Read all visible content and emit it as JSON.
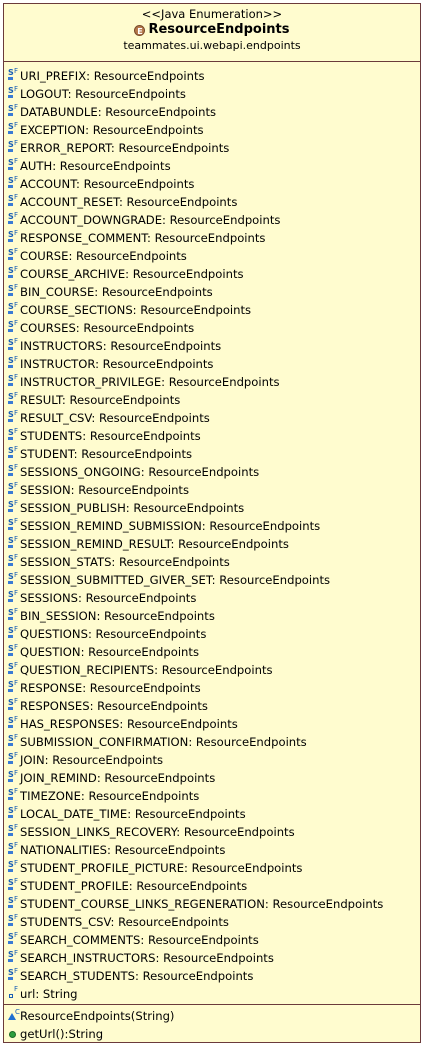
{
  "header": {
    "stereotype": "<<Java Enumeration>>",
    "icon_letter": "E",
    "name": "ResourceEndpoints",
    "package": "teammates.ui.webapi.endpoints"
  },
  "fields": [
    {
      "text": "URI_PREFIX: ResourceEndpoints"
    },
    {
      "text": "LOGOUT: ResourceEndpoints"
    },
    {
      "text": "DATABUNDLE: ResourceEndpoints"
    },
    {
      "text": "EXCEPTION: ResourceEndpoints"
    },
    {
      "text": "ERROR_REPORT: ResourceEndpoints"
    },
    {
      "text": "AUTH: ResourceEndpoints"
    },
    {
      "text": "ACCOUNT: ResourceEndpoints"
    },
    {
      "text": "ACCOUNT_RESET: ResourceEndpoints"
    },
    {
      "text": "ACCOUNT_DOWNGRADE: ResourceEndpoints"
    },
    {
      "text": "RESPONSE_COMMENT: ResourceEndpoints"
    },
    {
      "text": "COURSE: ResourceEndpoints"
    },
    {
      "text": "COURSE_ARCHIVE: ResourceEndpoints"
    },
    {
      "text": "BIN_COURSE: ResourceEndpoints"
    },
    {
      "text": "COURSE_SECTIONS: ResourceEndpoints"
    },
    {
      "text": "COURSES: ResourceEndpoints"
    },
    {
      "text": "INSTRUCTORS: ResourceEndpoints"
    },
    {
      "text": "INSTRUCTOR: ResourceEndpoints"
    },
    {
      "text": "INSTRUCTOR_PRIVILEGE: ResourceEndpoints"
    },
    {
      "text": "RESULT: ResourceEndpoints"
    },
    {
      "text": "RESULT_CSV: ResourceEndpoints"
    },
    {
      "text": "STUDENTS: ResourceEndpoints"
    },
    {
      "text": "STUDENT: ResourceEndpoints"
    },
    {
      "text": "SESSIONS_ONGOING: ResourceEndpoints"
    },
    {
      "text": "SESSION: ResourceEndpoints"
    },
    {
      "text": "SESSION_PUBLISH: ResourceEndpoints"
    },
    {
      "text": "SESSION_REMIND_SUBMISSION: ResourceEndpoints"
    },
    {
      "text": "SESSION_REMIND_RESULT: ResourceEndpoints"
    },
    {
      "text": "SESSION_STATS: ResourceEndpoints"
    },
    {
      "text": "SESSION_SUBMITTED_GIVER_SET: ResourceEndpoints"
    },
    {
      "text": "SESSIONS: ResourceEndpoints"
    },
    {
      "text": "BIN_SESSION: ResourceEndpoints"
    },
    {
      "text": "QUESTIONS: ResourceEndpoints"
    },
    {
      "text": "QUESTION: ResourceEndpoints"
    },
    {
      "text": "QUESTION_RECIPIENTS: ResourceEndpoints"
    },
    {
      "text": "RESPONSE: ResourceEndpoints"
    },
    {
      "text": "RESPONSES: ResourceEndpoints"
    },
    {
      "text": "HAS_RESPONSES: ResourceEndpoints"
    },
    {
      "text": "SUBMISSION_CONFIRMATION: ResourceEndpoints"
    },
    {
      "text": "JOIN: ResourceEndpoints"
    },
    {
      "text": "JOIN_REMIND: ResourceEndpoints"
    },
    {
      "text": "TIMEZONE: ResourceEndpoints"
    },
    {
      "text": "LOCAL_DATE_TIME: ResourceEndpoints"
    },
    {
      "text": "SESSION_LINKS_RECOVERY: ResourceEndpoints"
    },
    {
      "text": "NATIONALITIES: ResourceEndpoints"
    },
    {
      "text": "STUDENT_PROFILE_PICTURE: ResourceEndpoints"
    },
    {
      "text": "STUDENT_PROFILE: ResourceEndpoints"
    },
    {
      "text": "STUDENT_COURSE_LINKS_REGENERATION: ResourceEndpoints"
    },
    {
      "text": "STUDENTS_CSV: ResourceEndpoints"
    },
    {
      "text": "SEARCH_COMMENTS: ResourceEndpoints"
    },
    {
      "text": "SEARCH_INSTRUCTORS: ResourceEndpoints"
    },
    {
      "text": "SEARCH_STUDENTS: ResourceEndpoints"
    }
  ],
  "private_field": {
    "text": "url: String"
  },
  "methods": [
    {
      "text": "ResourceEndpoints(String)",
      "kind": "constructor"
    },
    {
      "text": "getUrl():String",
      "kind": "public"
    }
  ]
}
